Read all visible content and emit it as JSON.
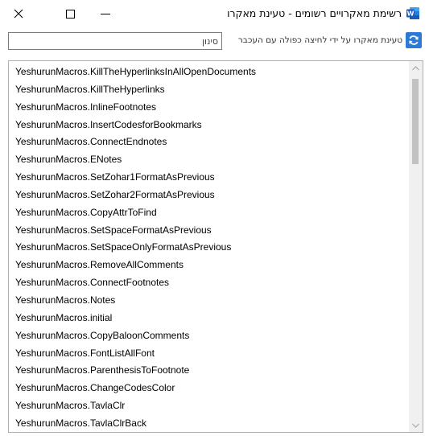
{
  "window": {
    "title": "רשימת מאקרויים רשומים - טעינת מאקרו",
    "app_icon": "word-icon"
  },
  "toolbar": {
    "search_placeholder": "סינון",
    "search_value": "",
    "reload_label": "טעינת מאקרו על ידי לחיצה כפולה עם העכבר",
    "refresh_icon": "refresh-icon"
  },
  "macros": [
    "YeshurunMacros.KillTheHyperlinksInAllOpenDocuments",
    "YeshurunMacros.KillTheHyperlinks",
    "YeshurunMacros.InlineFootnotes",
    "YeshurunMacros.InsertCodesforBookmarks",
    "YeshurunMacros.ConnectEndnotes",
    "YeshurunMacros.ENotes",
    "YeshurunMacros.SetZohar1FormatAsPrevious",
    "YeshurunMacros.SetZohar2FormatAsPrevious",
    "YeshurunMacros.CopyAttrToFind",
    "YeshurunMacros.SetSpaceFormatAsPrevious",
    "YeshurunMacros.SetSpaceOnlyFormatAsPrevious",
    "YeshurunMacros.RemoveAllComments",
    "YeshurunMacros.ConnectFootnotes",
    "YeshurunMacros.Notes",
    "YeshurunMacros.initial",
    "YeshurunMacros.CopyBaloonComments",
    "YeshurunMacros.FontListAllFont",
    "YeshurunMacros.ParenthesisToFootnote",
    "YeshurunMacros.ChangeCodesColor",
    "YeshurunMacros.TavlaClr",
    "YeshurunMacros.TavlaClrBack"
  ],
  "colors": {
    "refresh_button": "#2a7ad6",
    "word_icon": "#185abd"
  }
}
